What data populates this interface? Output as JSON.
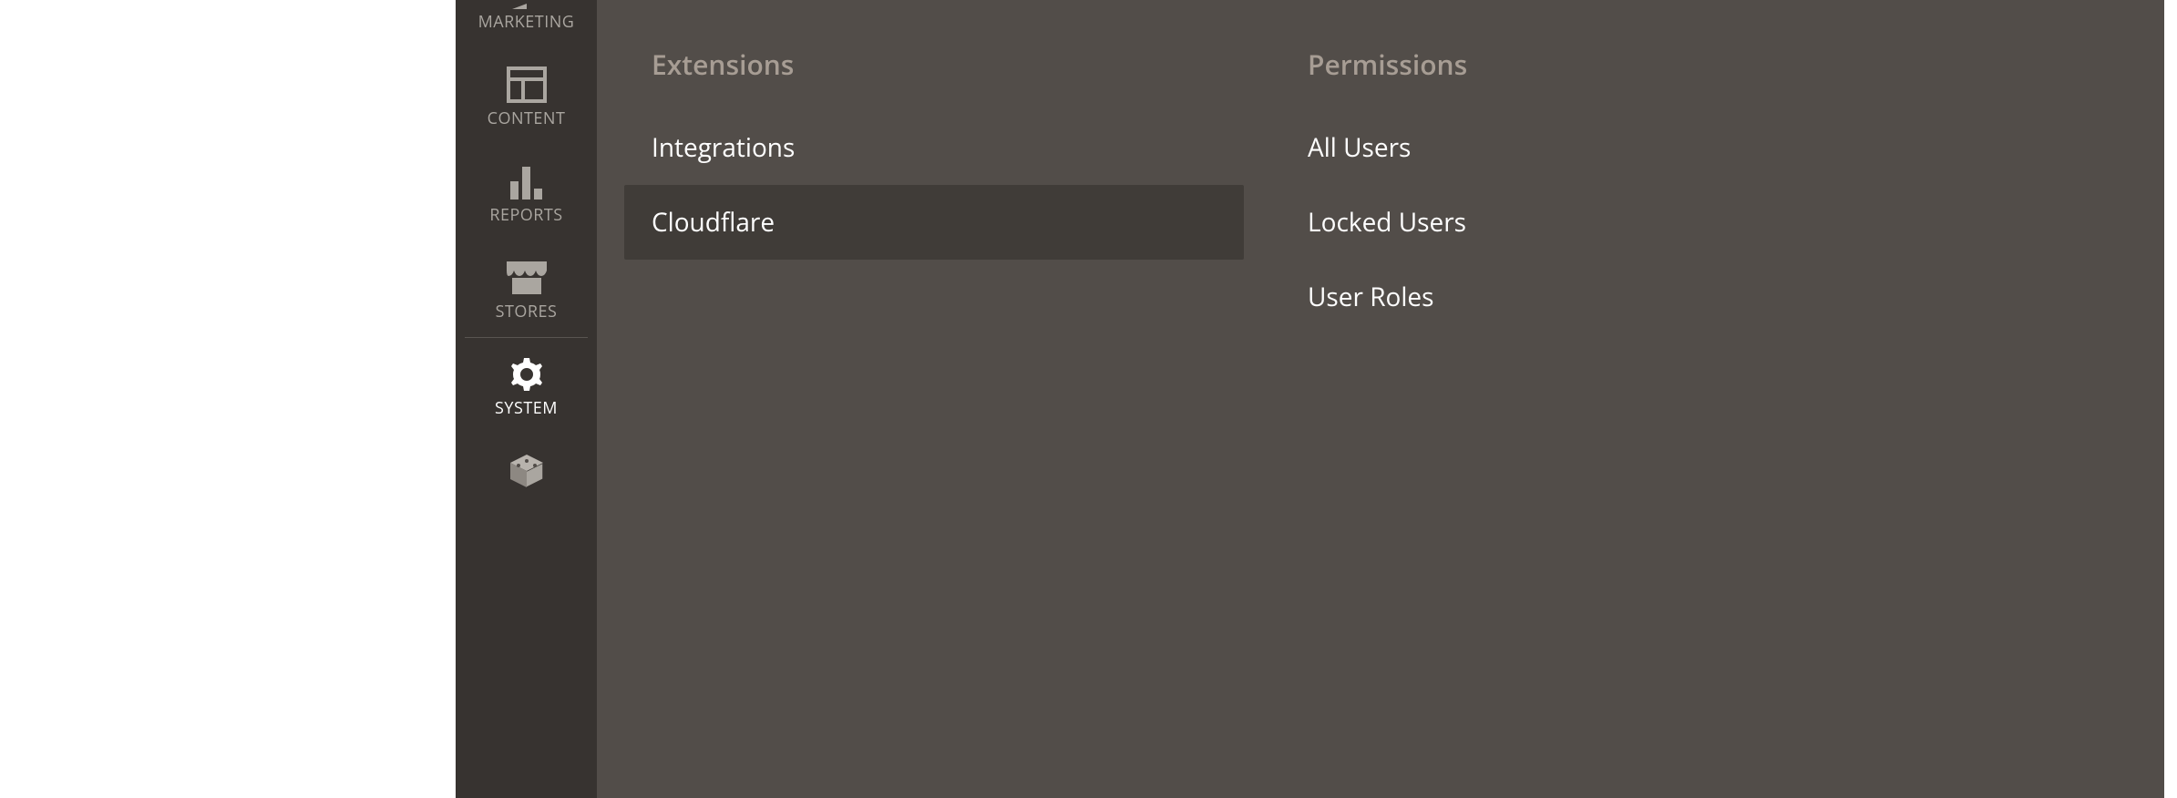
{
  "sidebar": {
    "items": [
      {
        "label": "MARKETING"
      },
      {
        "label": "CONTENT"
      },
      {
        "label": "REPORTS"
      },
      {
        "label": "STORES"
      },
      {
        "label": "SYSTEM"
      },
      {
        "label": ""
      }
    ]
  },
  "flyout": {
    "columns": [
      {
        "heading": "Extensions",
        "items": [
          "Integrations",
          "Cloudflare"
        ]
      },
      {
        "heading": "Permissions",
        "items": [
          "All Users",
          "Locked Users",
          "User Roles"
        ]
      }
    ]
  }
}
